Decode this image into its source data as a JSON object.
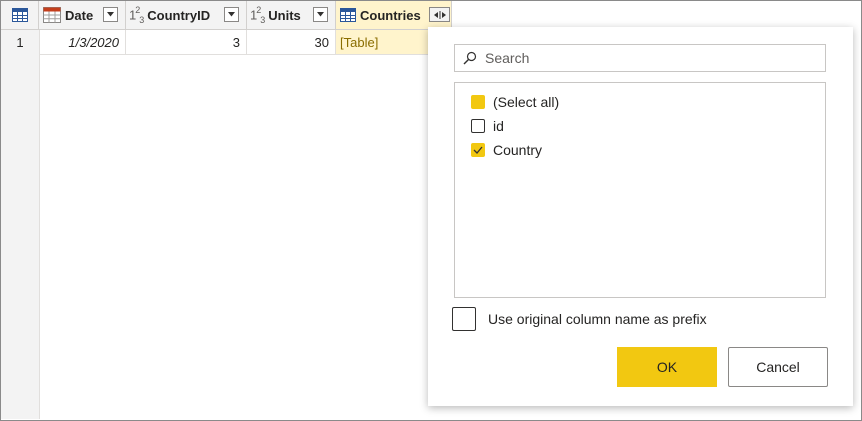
{
  "table": {
    "columns": [
      {
        "name": "Date",
        "type_icon": "calendar-table-icon"
      },
      {
        "name": "CountryID",
        "type_icon": "whole-number-icon",
        "type_text": "1²3"
      },
      {
        "name": "Units",
        "type_icon": "whole-number-icon",
        "type_text": "1²3"
      },
      {
        "name": "Countries",
        "type_icon": "table-icon"
      }
    ],
    "rows": [
      {
        "row_number": "1",
        "date": "1/3/2020",
        "country_id": "3",
        "units": "30",
        "countries": "[Table]"
      }
    ]
  },
  "expand_popup": {
    "search_placeholder": "Search",
    "items": [
      {
        "label": "(Select all)",
        "state": "partial"
      },
      {
        "label": "id",
        "state": "unchecked"
      },
      {
        "label": "Country",
        "state": "checked"
      }
    ],
    "prefix_label": "Use original column name as prefix",
    "prefix_checked": false,
    "ok_label": "OK",
    "cancel_label": "Cancel"
  },
  "colors": {
    "accent": "#f2c811",
    "header_bg": "#f3f3f3",
    "table_value": "#8a6d00"
  }
}
